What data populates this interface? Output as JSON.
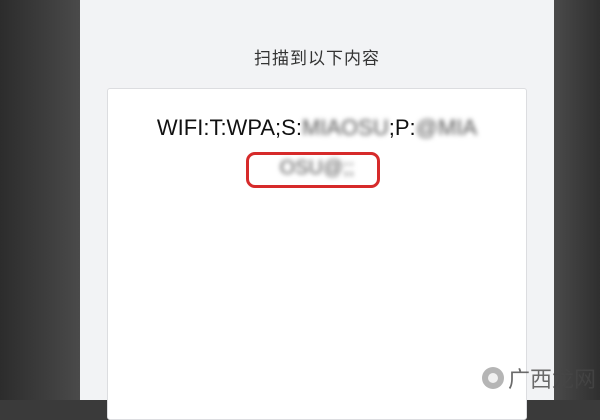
{
  "header": {
    "title": "扫描到以下内容"
  },
  "scan_result": {
    "prefix": "WIFI:T:WPA;S:",
    "ssid": "MIAOSU",
    "separator": ";P:",
    "password_part1": "@MIA",
    "password_part2": "OSU@;;"
  },
  "watermark": {
    "text": "广西龙网"
  },
  "colors": {
    "highlight": "#d62a2a",
    "background": "#f2f3f5"
  }
}
